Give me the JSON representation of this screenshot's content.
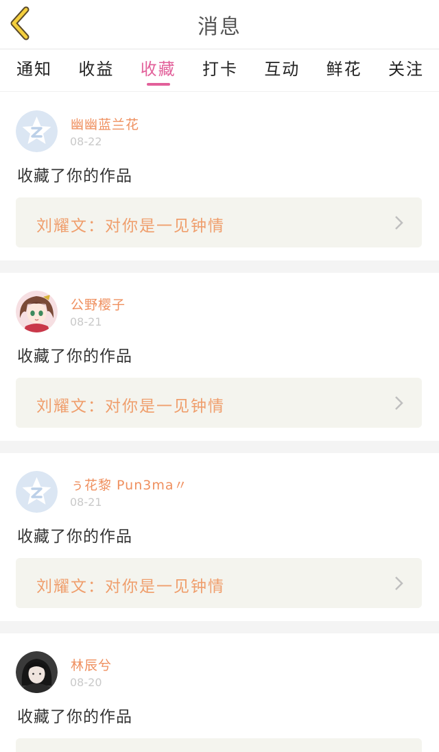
{
  "header": {
    "title": "消息",
    "back_icon": "chevron-left-icon"
  },
  "tabs": [
    {
      "label": "通知",
      "active": false
    },
    {
      "label": "收益",
      "active": false
    },
    {
      "label": "收藏",
      "active": true
    },
    {
      "label": "打卡",
      "active": false
    },
    {
      "label": "互动",
      "active": false
    },
    {
      "label": "鲜花",
      "active": false
    },
    {
      "label": "关注",
      "active": false
    }
  ],
  "colors": {
    "accent": "#e2609a",
    "username": "#ef8f5e",
    "work_title": "#ef9e6c",
    "work_bg": "#f4f4ee"
  },
  "messages": [
    {
      "username": "幽幽蓝兰花",
      "date": "08-22",
      "action": "收藏了你的作品",
      "work": "刘耀文：对你是一见钟情",
      "avatar": "default-avatar-icon"
    },
    {
      "username": "公野樱子",
      "date": "08-21",
      "action": "收藏了你的作品",
      "work": "刘耀文：对你是一见钟情",
      "avatar": "anime-girl-avatar"
    },
    {
      "username": "ぅ花黎 Pun3ma〃",
      "date": "08-21",
      "action": "收藏了你的作品",
      "work": "刘耀文：对你是一见钟情",
      "avatar": "default-avatar-icon"
    },
    {
      "username": "林辰兮",
      "date": "08-20",
      "action": "收藏了你的作品",
      "work": "",
      "avatar": "photo-avatar"
    }
  ]
}
